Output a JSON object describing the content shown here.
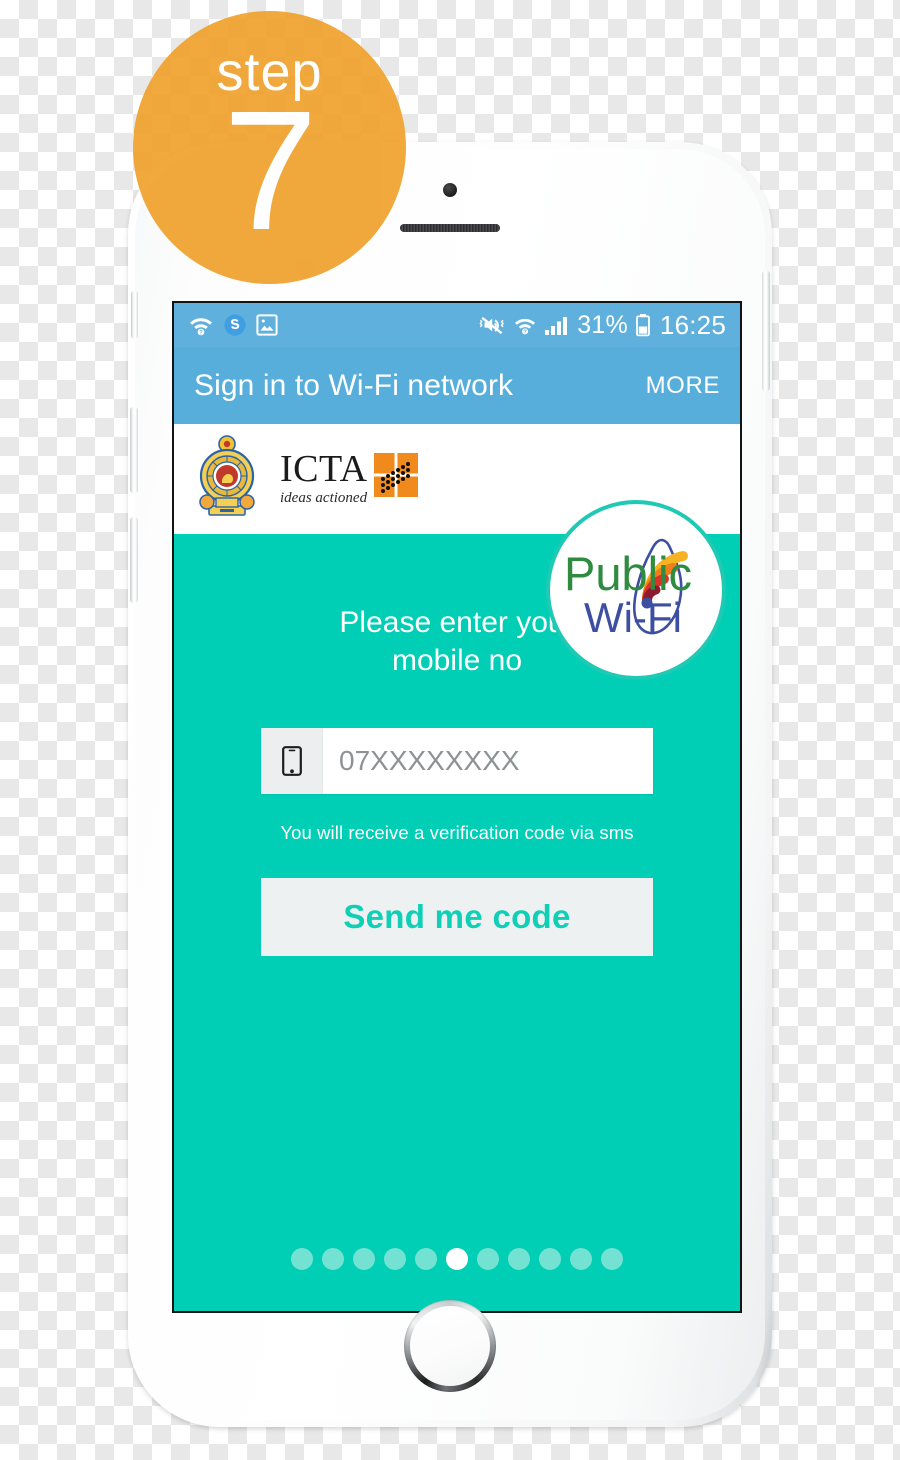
{
  "badge": {
    "word": "step",
    "number": "7",
    "color": "#F0A22E"
  },
  "status_bar": {
    "left_icons": [
      "wifi-question-icon",
      "skype-icon",
      "image-icon"
    ],
    "right_icons": [
      "mute-vibrate-icon",
      "wifi-question-icon",
      "signal-bars-icon",
      "battery-icon"
    ],
    "battery_percent": "31%",
    "clock": "16:25",
    "background": "#5FB0DD"
  },
  "app_bar": {
    "title": "Sign in to Wi-Fi network",
    "more_label": "MORE",
    "background": "#58AEDA"
  },
  "branding": {
    "emblem_name": "sri-lanka-government-emblem",
    "icta_word": "ICTA",
    "icta_tagline": "ideas actioned",
    "wifi_badge": {
      "line1": "Public",
      "line2": "Wi-Fi",
      "line1_color": "#2E8B3F",
      "line2_color": "#3C4FA0",
      "ring_color": "#1FC9B4"
    }
  },
  "main": {
    "prompt_line1": "Please enter your",
    "prompt_line2": "mobile no",
    "phone_input": {
      "value": "",
      "placeholder": "07XXXXXXXX",
      "icon": "mobile-phone-icon"
    },
    "hint": "You will receive a verification code via sms",
    "send_button_label": "Send me code",
    "background": "#00CFB6",
    "button_bg": "#EDF1F1",
    "button_text_color": "#0FD0B6"
  },
  "pager": {
    "total": 11,
    "active_index": 5
  }
}
